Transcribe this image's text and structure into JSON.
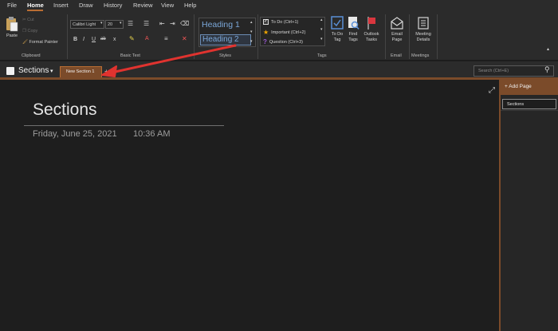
{
  "tabs": [
    "File",
    "Home",
    "Insert",
    "Draw",
    "History",
    "Review",
    "View",
    "Help"
  ],
  "clipboard": {
    "paste": "Paste",
    "cut": "Cut",
    "copy": "Copy",
    "format_painter": "Format Painter",
    "label": "Clipboard"
  },
  "basic_text": {
    "font_name": "Calibri Light",
    "font_size": "20",
    "bold": "B",
    "italic": "I",
    "underline": "U",
    "strike": "ab",
    "subscript": "x",
    "clear": "A",
    "label": "Basic Text"
  },
  "styles": {
    "heading1": "Heading 1",
    "heading2": "Heading 2",
    "label": "Styles"
  },
  "tags": {
    "items": [
      "To Do (Ctrl+1)",
      "Important (Ctrl+2)",
      "Question (Ctrl+3)"
    ],
    "todo_tag": "To Do Tag",
    "find_tags": "Find Tags",
    "outlook_tasks": "Outlook Tasks",
    "label": "Tags"
  },
  "email": {
    "email_page": "Email Page",
    "label": "Email"
  },
  "meetings": {
    "meeting_details": "Meeting Details",
    "label": "Meetings"
  },
  "notebook": {
    "name": "Sections",
    "section_tab": "New Section 1",
    "search_placeholder": "Search (Ctrl+E)"
  },
  "page": {
    "title": "Sections",
    "date": "Friday, June 25, 2021",
    "time": "10:36 AM"
  },
  "pages_pane": {
    "add_page": "Add Page",
    "items": [
      "Sections"
    ]
  },
  "colors": {
    "accent": "#b96d33",
    "section_brown": "#7b4b2a",
    "annotation_red": "#e0332f"
  }
}
